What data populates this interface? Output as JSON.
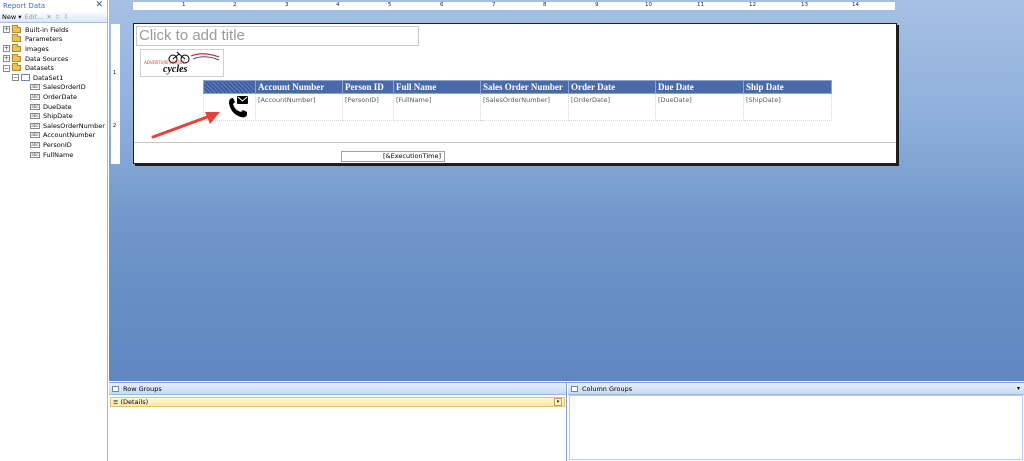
{
  "panel": {
    "title": "Report Data",
    "close_glyph": "✕",
    "toolbar": {
      "new_label": "New",
      "new_arrow": "▾",
      "edit_label": "Edit...",
      "delete_glyph": "✕",
      "up_glyph": "⇧",
      "down_glyph": "⇩"
    },
    "tree": {
      "built_in_fields": "Built-in Fields",
      "parameters": "Parameters",
      "images": "Images",
      "data_sources": "Data Sources",
      "datasets": "Datasets",
      "dataset1": "DataSet1",
      "fields": [
        "SalesOrderID",
        "OrderDate",
        "DueDate",
        "ShipDate",
        "SalesOrderNumber",
        "AccountNumber",
        "PersonID",
        "FullName"
      ]
    }
  },
  "ruler": {
    "numbers": [
      "1",
      "2",
      "3",
      "4",
      "5",
      "6",
      "7",
      "8",
      "9",
      "10",
      "11",
      "12",
      "13",
      "14"
    ],
    "left_numbers": [
      "1",
      "2"
    ]
  },
  "report": {
    "title_placeholder": "Click to add title",
    "logo": {
      "adventure_text": "ADVENTURE WORKS",
      "cycles_text": "cycles"
    },
    "table": {
      "headers": [
        "Account Number",
        "Person ID",
        "Full Name",
        "Sales Order Number",
        "Order Date",
        "Due Date",
        "Ship Date"
      ],
      "row": [
        "[AccountNumber]",
        "[PersonID]",
        "[FullName]",
        "[SalesOrderNumber]",
        "[OrderDate]",
        "[DueDate]",
        "[ShipDate]"
      ]
    },
    "execution_time": "[&ExecutionTime]"
  },
  "groups": {
    "row_groups_label": "Row Groups",
    "column_groups_label": "Column Groups",
    "details_label": "≡ (Details)",
    "dropdown_glyph": "▾"
  },
  "colors": {
    "header_bg": "#4a69a8",
    "arrow": "#e8403a",
    "canvas_top": "#a6c0e4",
    "canvas_bottom": "#5f87c0"
  }
}
